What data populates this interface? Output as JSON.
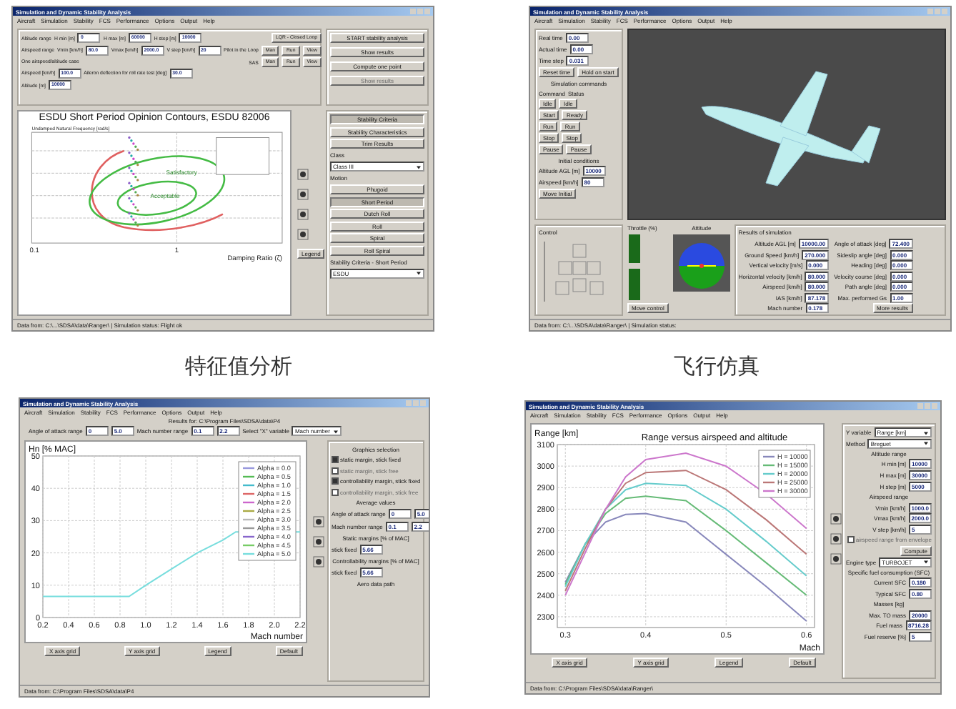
{
  "panels": [
    {
      "kind": "stability",
      "title": "Simulation and Dynamic Stability Analysis",
      "menu": [
        "Aircraft",
        "Simulation",
        "Stability",
        "FCS",
        "Performance",
        "Options",
        "Output",
        "Help"
      ],
      "form": [
        [
          {
            "kind": "label",
            "text": "Altitude range"
          },
          {
            "kind": "label",
            "text": "H min [m]"
          },
          {
            "kind": "field",
            "value": "0"
          },
          {
            "kind": "label",
            "text": "H max [m]"
          },
          {
            "kind": "field",
            "value": "60000"
          },
          {
            "kind": "label",
            "text": "H step [m]"
          },
          {
            "kind": "field",
            "value": "10000"
          }
        ],
        [
          {
            "kind": "label",
            "text": "Airspeed range"
          },
          {
            "kind": "label",
            "text": "Vmin [km/h]"
          },
          {
            "kind": "field",
            "value": "80.0"
          },
          {
            "kind": "label",
            "text": "Vmax [km/h]"
          },
          {
            "kind": "field",
            "value": "2000.0"
          },
          {
            "kind": "label",
            "text": "V step [km/h]"
          },
          {
            "kind": "field",
            "value": "20"
          }
        ],
        [
          {
            "kind": "label",
            "text": "One airspeed/altitude case"
          }
        ],
        [
          {
            "kind": "label",
            "text": "Airspeed [km/h]"
          },
          {
            "kind": "field",
            "value": "100.0"
          },
          {
            "kind": "label",
            "text": "Aileron deflection for roll rate test [deg]"
          },
          {
            "kind": "field",
            "value": "30.0"
          }
        ],
        [
          {
            "kind": "label",
            "text": "Altitude [m]"
          },
          {
            "kind": "field",
            "value": "10000"
          }
        ]
      ],
      "loop": [
        [
          {
            "kind": "button",
            "text": "LQR - Closed Loop"
          }
        ],
        [
          {
            "kind": "label",
            "text": "Pilot in the Loop"
          },
          {
            "kind": "button",
            "text": "Man"
          },
          {
            "kind": "button",
            "text": "Run"
          },
          {
            "kind": "button",
            "text": "View"
          }
        ],
        [
          {
            "kind": "label",
            "text": "SAS"
          },
          {
            "kind": "button",
            "text": "Man"
          },
          {
            "kind": "button",
            "text": "Run"
          },
          {
            "kind": "button",
            "text": "View"
          }
        ]
      ],
      "actions": [
        [
          {
            "kind": "button",
            "text": "START stability analysis",
            "disabled": false
          }
        ],
        [
          {
            "kind": "button",
            "text": "Show results",
            "disabled": false
          }
        ],
        [
          {
            "kind": "button",
            "text": "Compute one point",
            "disabled": false
          }
        ],
        [
          {
            "kind": "button",
            "text": "Show results",
            "disabled": true
          }
        ]
      ],
      "chart": {
        "title": "ESDU Short Period Opinion Contours, ESDU 82006",
        "ylabel": "Undamped Natural Frequency [rad/s]",
        "xlabel": "Damping Ratio (ζ)",
        "regions": [
          "Satisfactory",
          "Acceptable"
        ],
        "xticks": [
          "0.1",
          "1"
        ]
      },
      "chart_tools": [
        [
          {
            "kind": "button",
            "text": "Legend"
          }
        ]
      ],
      "side": [
        [
          {
            "kind": "button",
            "text": "Stability Criteria",
            "selected": true
          }
        ],
        [
          {
            "kind": "button",
            "text": "Stability Characteristics",
            "selected": false
          }
        ],
        [
          {
            "kind": "button",
            "text": "Trim Results",
            "selected": false
          }
        ],
        [
          {
            "kind": "label",
            "text": "Class"
          }
        ],
        [
          {
            "kind": "select",
            "value": "Class III"
          }
        ],
        [
          {
            "kind": "label",
            "text": "Motion"
          }
        ],
        [
          {
            "kind": "button",
            "text": "Phugoid",
            "selected": false
          }
        ],
        [
          {
            "kind": "button",
            "text": "Short Period",
            "selected": true
          }
        ],
        [
          {
            "kind": "button",
            "text": "Dutch Roll",
            "selected": false
          }
        ],
        [
          {
            "kind": "button",
            "text": "Roll",
            "selected": false
          }
        ],
        [
          {
            "kind": "button",
            "text": "Spiral",
            "selected": false
          }
        ],
        [
          {
            "kind": "button",
            "text": "Roll Spiral",
            "selected": false
          }
        ],
        [
          {
            "kind": "label",
            "text": "Stability Criteria - Short Period"
          }
        ],
        [
          {
            "kind": "select",
            "value": "ESDU"
          }
        ]
      ],
      "status": "Data from: C:\\...\\SDSA\\data\\Ranger\\ | Simulation status: Flight ok",
      "caption": "特征值分析"
    },
    {
      "kind": "simulation",
      "title": "Simulation and Dynamic Stability Analysis",
      "menu": [
        "Aircraft",
        "Simulation",
        "Stability",
        "FCS",
        "Performance",
        "Options",
        "Output",
        "Help"
      ],
      "left": [
        [
          {
            "kind": "label",
            "text": "Real time"
          },
          {
            "kind": "field",
            "value": "0.00"
          }
        ],
        [
          {
            "kind": "label",
            "text": "Actual time"
          },
          {
            "kind": "field",
            "value": "0.00"
          }
        ],
        [
          {
            "kind": "label",
            "text": "Time step"
          },
          {
            "kind": "field",
            "value": "0.031"
          }
        ],
        [
          {
            "kind": "button",
            "text": "Reset time"
          },
          {
            "kind": "button",
            "text": "Hold on start"
          }
        ],
        [
          {
            "kind": "heading",
            "text": "Simulation commands"
          }
        ],
        [
          {
            "kind": "label",
            "text": "Command"
          },
          {
            "kind": "label",
            "text": "Status"
          }
        ],
        [
          {
            "kind": "button",
            "text": "Idle"
          },
          {
            "kind": "button",
            "text": "Idle"
          }
        ],
        [
          {
            "kind": "button",
            "text": "Start"
          },
          {
            "kind": "button",
            "text": "Ready"
          }
        ],
        [
          {
            "kind": "button",
            "text": "Run"
          },
          {
            "kind": "button",
            "text": "Run"
          }
        ],
        [
          {
            "kind": "button",
            "text": "Stop"
          },
          {
            "kind": "button",
            "text": "Stop"
          }
        ],
        [
          {
            "kind": "button",
            "text": "Pause"
          },
          {
            "kind": "button",
            "text": "Pause"
          }
        ],
        [
          {
            "kind": "heading",
            "text": "Initial conditions"
          }
        ],
        [
          {
            "kind": "label",
            "text": "Altitude AGL [m]"
          },
          {
            "kind": "field",
            "value": "10000"
          }
        ],
        [
          {
            "kind": "label",
            "text": "Airspeed [km/h]"
          },
          {
            "kind": "field",
            "value": "80"
          }
        ],
        [
          {
            "kind": "button",
            "text": "Move Initial"
          }
        ]
      ],
      "control_label": "Control",
      "throttle_label": "Throttle (%)",
      "attitude_label": "Attitude",
      "results_label": "Results of simulation",
      "control_buttons": [
        [
          {
            "kind": "button",
            "text": "Move control"
          }
        ]
      ],
      "results": [
        [
          {
            "kind": "label",
            "text": "Altitude AGL [m]"
          },
          {
            "kind": "field",
            "value": "10000.00"
          }
        ],
        [
          {
            "kind": "label",
            "text": "Ground Speed [km/h]"
          },
          {
            "kind": "field",
            "value": "270.000"
          }
        ],
        [
          {
            "kind": "label",
            "text": "Vertical velocity [m/s]"
          },
          {
            "kind": "field",
            "value": "0.000"
          }
        ],
        [
          {
            "kind": "label",
            "text": "Horizontal velocity [km/h]"
          },
          {
            "kind": "field",
            "value": "80.000"
          }
        ],
        [
          {
            "kind": "label",
            "text": "Airspeed [km/h]"
          },
          {
            "kind": "field",
            "value": "80.000"
          }
        ],
        [
          {
            "kind": "label",
            "text": "IAS [km/h]"
          },
          {
            "kind": "field",
            "value": "87.178"
          }
        ],
        [
          {
            "kind": "label",
            "text": "Mach number"
          },
          {
            "kind": "field",
            "value": "0.178"
          }
        ]
      ],
      "results_2": [
        [
          {
            "kind": "label",
            "text": "Angle of attack [deg]"
          },
          {
            "kind": "field",
            "value": "72.400"
          }
        ],
        [
          {
            "kind": "label",
            "text": "Sideslip angle [deg]"
          },
          {
            "kind": "field",
            "value": "0.000"
          }
        ],
        [
          {
            "kind": "label",
            "text": "Heading [deg]"
          },
          {
            "kind": "field",
            "value": "0.000"
          }
        ],
        [
          {
            "kind": "label",
            "text": "Velocity course [deg]"
          },
          {
            "kind": "field",
            "value": "0.000"
          }
        ],
        [
          {
            "kind": "label",
            "text": "Path angle [deg]"
          },
          {
            "kind": "field",
            "value": "0.000"
          }
        ],
        [
          {
            "kind": "label",
            "text": "Max. performed Gs"
          },
          {
            "kind": "field",
            "value": "1.00"
          }
        ],
        [
          {
            "kind": "button",
            "text": "More results"
          }
        ]
      ],
      "status": "Data from: C:\\...\\SDSA\\data\\Ranger\\ | Simulation status:",
      "caption": "飞行仿真"
    },
    {
      "kind": "margins",
      "title": "Simulation and Dynamic Stability Analysis",
      "menu": [
        "Aircraft",
        "Simulation",
        "Stability",
        "FCS",
        "Performance",
        "Options",
        "Output",
        "Help"
      ],
      "header": "Results for: C:\\Program Files\\SDSA\\data\\P4",
      "controls": [
        [
          {
            "kind": "label",
            "text": "Angle of attack range"
          },
          {
            "kind": "field",
            "value": "0"
          },
          {
            "kind": "field",
            "value": "5.0"
          },
          {
            "kind": "label",
            "text": "Mach number range"
          },
          {
            "kind": "field",
            "value": "0.1"
          },
          {
            "kind": "field",
            "value": "2.2"
          },
          {
            "kind": "label",
            "text": "Select \"X\" variable"
          },
          {
            "kind": "select",
            "value": "Mach number"
          }
        ]
      ],
      "chart_data": {
        "type": "line",
        "xlabel": "Mach number",
        "ylabel": "Hn [% MAC]",
        "xlim": [
          0.2,
          2.2
        ],
        "ylim": [
          0,
          50
        ],
        "xticks": [
          0.2,
          0.4,
          0.6,
          0.8,
          {
            "value": 1,
            "label": "1.0"
          },
          1.2,
          1.4,
          1.6,
          1.8,
          {
            "value": 2,
            "label": "2.0"
          },
          2.2
        ],
        "yticks": [
          0,
          10,
          20,
          30,
          40,
          50
        ],
        "grid": true,
        "legend": "upper right",
        "x": [
          0.2,
          0.87,
          1.0,
          1.2,
          1.4,
          1.6,
          1.7,
          2.2
        ],
        "series": [
          {
            "name": "Alpha = 0.0",
            "color": "#9999dd",
            "values": [
              null,
              null,
              null,
              null,
              null,
              null,
              null,
              null
            ]
          },
          {
            "name": "Alpha = 0.5",
            "color": "#55bb55",
            "values": [
              null,
              null,
              null,
              null,
              null,
              null,
              null,
              null
            ]
          },
          {
            "name": "Alpha = 1.0",
            "color": "#44bbcc",
            "values": [
              null,
              null,
              null,
              null,
              null,
              null,
              null,
              null
            ]
          },
          {
            "name": "Alpha = 1.5",
            "color": "#dd6666",
            "values": [
              null,
              null,
              null,
              null,
              null,
              null,
              null,
              null
            ]
          },
          {
            "name": "Alpha = 2.0",
            "color": "#cc66cc",
            "values": [
              null,
              null,
              null,
              null,
              null,
              null,
              null,
              null
            ]
          },
          {
            "name": "Alpha = 2.5",
            "color": "#aaaa44",
            "values": [
              null,
              null,
              null,
              null,
              null,
              null,
              null,
              null
            ]
          },
          {
            "name": "Alpha = 3.0",
            "color": "#b8b8b8",
            "values": [
              null,
              null,
              null,
              null,
              null,
              null,
              null,
              null
            ]
          },
          {
            "name": "Alpha = 3.5",
            "color": "#999999",
            "values": [
              null,
              null,
              null,
              null,
              null,
              null,
              null,
              null
            ]
          },
          {
            "name": "Alpha = 4.0",
            "color": "#8866cc",
            "values": [
              null,
              null,
              null,
              null,
              null,
              null,
              null,
              null
            ]
          },
          {
            "name": "Alpha = 4.5",
            "color": "#77cc66",
            "values": [
              null,
              null,
              null,
              null,
              null,
              null,
              null,
              null
            ]
          },
          {
            "name": "Alpha = 5.0",
            "color": "#77dddd",
            "values": [
              6.5,
              6.5,
              10,
              15,
              20,
              24,
              26.5,
              26.5
            ]
          }
        ]
      },
      "chart_tools": [
        [
          {
            "kind": "button",
            "text": "X axis grid"
          },
          {
            "kind": "button",
            "text": "Y axis grid"
          },
          {
            "kind": "button",
            "text": "Legend"
          },
          {
            "kind": "button",
            "text": "Default"
          }
        ]
      ],
      "side": [
        [
          {
            "kind": "heading",
            "text": "Graphics selection"
          }
        ],
        [
          {
            "kind": "check",
            "text": "static margin, stick fixed",
            "checked": true
          }
        ],
        [
          {
            "kind": "check",
            "text": "static margin, stick free",
            "checked": false
          }
        ],
        [
          {
            "kind": "check",
            "text": "controllability margin, stick fixed",
            "checked": true
          }
        ],
        [
          {
            "kind": "check",
            "text": "controllability margin, stick free",
            "checked": false
          }
        ],
        [
          {
            "kind": "heading",
            "text": "Average values"
          }
        ],
        [
          {
            "kind": "label",
            "text": "Angle of attack range"
          },
          {
            "kind": "field",
            "value": "0"
          },
          {
            "kind": "field",
            "value": "5.0"
          }
        ],
        [
          {
            "kind": "label",
            "text": "Mach number range"
          },
          {
            "kind": "field",
            "value": "0.1"
          },
          {
            "kind": "field",
            "value": "2.2"
          }
        ],
        [
          {
            "kind": "heading",
            "text": "Static margins [% of MAC]"
          }
        ],
        [
          {
            "kind": "label",
            "text": "stick fixed"
          },
          {
            "kind": "field",
            "value": "5.66"
          }
        ],
        [
          {
            "kind": "heading",
            "text": "Controllability margins [% of MAC]"
          }
        ],
        [
          {
            "kind": "label",
            "text": "stick fixed"
          },
          {
            "kind": "field",
            "value": "5.66"
          }
        ],
        [
          {
            "kind": "heading",
            "text": "Aero data path"
          }
        ]
      ],
      "status": "Data from: C:\\Program Files\\SDSA\\data\\P4"
    },
    {
      "kind": "range",
      "title": "Simulation and Dynamic Stability Analysis",
      "menu": [
        "Aircraft",
        "Simulation",
        "Stability",
        "FCS",
        "Performance",
        "Options",
        "Output",
        "Help"
      ],
      "chart_data": {
        "type": "line",
        "title": "Range versus airspeed and altitude",
        "xlabel": "Mach",
        "ylabel": "Range [km]",
        "xlim": [
          0.29,
          0.61
        ],
        "ylim": [
          2250,
          3100
        ],
        "xticks": [
          0.3,
          0.4,
          0.5,
          0.6
        ],
        "yticks": [
          2300,
          2400,
          2500,
          2600,
          2700,
          2800,
          2900,
          3000,
          3100
        ],
        "grid": true,
        "legend": "upper right",
        "x": [
          0.3,
          0.325,
          0.35,
          0.375,
          0.4,
          0.45,
          0.5,
          0.55,
          0.6
        ],
        "series": [
          {
            "name": "H = 10000",
            "color": "#8888bb",
            "values": [
              2460,
              2640,
              2740,
              2775,
              2780,
              2740,
              2590,
              2440,
              2280
            ]
          },
          {
            "name": "H = 15000",
            "color": "#66bb77",
            "values": [
              2450,
              2640,
              2780,
              2850,
              2860,
              2840,
              2700,
              2550,
              2400
            ]
          },
          {
            "name": "H = 20000",
            "color": "#66cccc",
            "values": [
              2440,
              2640,
              2800,
              2890,
              2920,
              2910,
              2800,
              2650,
              2490
            ]
          },
          {
            "name": "H = 25000",
            "color": "#bb7777",
            "values": [
              2420,
              2620,
              2800,
              2920,
              2970,
              2980,
              2890,
              2750,
              2590
            ]
          },
          {
            "name": "H = 30000",
            "color": "#cc77cc",
            "values": [
              2400,
              2600,
              2800,
              2950,
              3030,
              3060,
              3000,
              2870,
              2710
            ]
          }
        ]
      },
      "chart_tools": [
        [
          {
            "kind": "button",
            "text": "X axis grid"
          },
          {
            "kind": "button",
            "text": "Y axis grid"
          },
          {
            "kind": "button",
            "text": "Legend"
          },
          {
            "kind": "button",
            "text": "Default"
          }
        ]
      ],
      "side": [
        [
          {
            "kind": "label",
            "text": "Y variable"
          },
          {
            "kind": "select",
            "value": "Range [km]"
          }
        ],
        [
          {
            "kind": "label",
            "text": "Method"
          },
          {
            "kind": "select",
            "value": "Breguet"
          }
        ],
        [
          {
            "kind": "heading",
            "text": "Altitude range"
          }
        ],
        [
          {
            "kind": "label",
            "text": "H min [m]"
          },
          {
            "kind": "field",
            "value": "10000"
          }
        ],
        [
          {
            "kind": "label",
            "text": "H max [m]"
          },
          {
            "kind": "field",
            "value": "30000"
          }
        ],
        [
          {
            "kind": "label",
            "text": "H step [m]"
          },
          {
            "kind": "field",
            "value": "5000"
          }
        ],
        [
          {
            "kind": "heading",
            "text": "Airspeed range"
          }
        ],
        [
          {
            "kind": "label",
            "text": "Vmin [km/h]"
          },
          {
            "kind": "field",
            "value": "1000.0"
          }
        ],
        [
          {
            "kind": "label",
            "text": "Vmax [km/h]"
          },
          {
            "kind": "field",
            "value": "2000.0"
          }
        ],
        [
          {
            "kind": "label",
            "text": "V step [km/h]"
          },
          {
            "kind": "field",
            "value": "5"
          }
        ],
        [
          {
            "kind": "check",
            "text": "airspeed range from envelope",
            "checked": false
          }
        ],
        [
          {
            "kind": "button",
            "text": "Compute"
          }
        ],
        [
          {
            "kind": "label",
            "text": "Engine type"
          },
          {
            "kind": "select",
            "value": "TURBOJET"
          }
        ],
        [
          {
            "kind": "heading",
            "text": "Specific fuel consumption (SFC)"
          }
        ],
        [
          {
            "kind": "label",
            "text": "Current SFC"
          },
          {
            "kind": "field",
            "value": "0.180"
          }
        ],
        [
          {
            "kind": "label",
            "text": "Typical SFC"
          },
          {
            "kind": "field",
            "value": "0.80"
          }
        ],
        [
          {
            "kind": "heading",
            "text": "Masses [kg]"
          }
        ],
        [
          {
            "kind": "label",
            "text": "Max. TO mass"
          },
          {
            "kind": "field",
            "value": "20000"
          }
        ],
        [
          {
            "kind": "label",
            "text": "Fuel mass"
          },
          {
            "kind": "field",
            "value": "8716.28"
          }
        ],
        [
          {
            "kind": "label",
            "text": "Fuel reserve [%]"
          },
          {
            "kind": "field",
            "value": "5"
          }
        ]
      ],
      "status": "Data from: C:\\Program Files\\SDSA\\data\\Ranger\\"
    }
  ]
}
